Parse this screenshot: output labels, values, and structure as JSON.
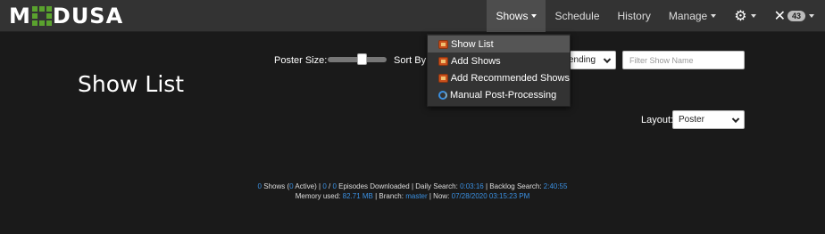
{
  "brand": {
    "text_left": "M",
    "text_right": "DUSA",
    "logo_color": "#5aa22e"
  },
  "nav": {
    "shows": "Shows",
    "schedule": "Schedule",
    "history": "History",
    "manage": "Manage",
    "badge_count": "43"
  },
  "dropdown": {
    "items": [
      {
        "label": "Show List",
        "icon": "tv-icon"
      },
      {
        "label": "Add Shows",
        "icon": "tv-icon"
      },
      {
        "label": "Add Recommended Shows",
        "icon": "tv-icon"
      },
      {
        "label": "Manual Post-Processing",
        "icon": "sync-icon"
      }
    ]
  },
  "controls": {
    "poster_size_label": "Poster Size:",
    "poster_size_value": 0.6,
    "sort_by_label": "Sort By:",
    "sort_direction_value": "ending",
    "filter_placeholder": "Filter Show Name",
    "layout_label": "Layout:",
    "layout_value": "Poster"
  },
  "page": {
    "title": "Show List"
  },
  "footer": {
    "shows_count": "0",
    "shows_text": " Shows (",
    "active_count": "0",
    "active_text": " Active) | ",
    "episodes_downloaded": "0",
    "slash": " / ",
    "episodes_total": "0",
    "episodes_text": " Episodes Downloaded | Daily Search: ",
    "daily_search": "0:03:16",
    "backlog_text": " | Backlog Search: ",
    "backlog_search": "2:40:55",
    "memory_text": "Memory used: ",
    "memory_used": "82.71 MB",
    "branch_text": " | Branch: ",
    "branch": "master",
    "now_text": " | Now: ",
    "now": "07/28/2020 03:15:23 PM"
  },
  "colors": {
    "accent": "#3a8fe0",
    "navbar": "#333333",
    "background": "#1a1a1a"
  }
}
